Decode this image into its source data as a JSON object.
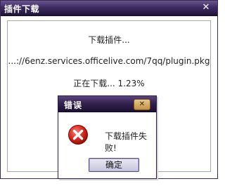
{
  "main_window": {
    "title": "插件下载",
    "close_glyph": "✕",
    "heading": "下载插件...",
    "url": "...://6enz.services.officelive.com/7qq/plugin.pkg",
    "status": "正在下载... 1.23%"
  },
  "error_dialog": {
    "title": "错误",
    "close_glyph": "✕",
    "icon": "error-icon",
    "message": "下载插件失败!",
    "ok_label": "确定"
  },
  "colors": {
    "titlebar": "#3f2b63",
    "error_red": "#d9281e"
  }
}
